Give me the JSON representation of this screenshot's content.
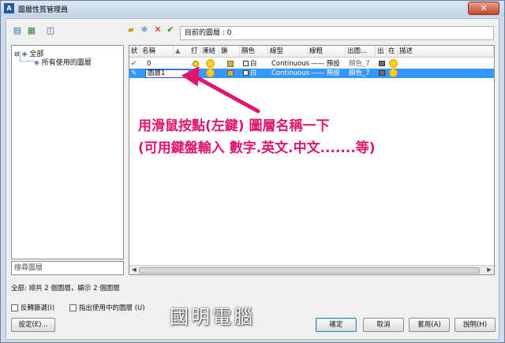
{
  "window": {
    "title": "圖層性質管理員",
    "close_glyph": "✕"
  },
  "toolbar": {
    "left_icons": [
      "new-property-filter-icon",
      "new-group-filter-icon",
      "layer-states-icon"
    ],
    "right_icons": [
      "new-layer-icon",
      "new-layer-vp-frozen-icon",
      "delete-layer-icon",
      "set-current-icon"
    ],
    "current_layer_label": "目前的圖層 : 0"
  },
  "filter_tree": {
    "items": [
      "全部",
      "所有使用的圖層"
    ]
  },
  "search": {
    "placeholder": "搜尋圖層"
  },
  "grid": {
    "headers": [
      "狀",
      "名稱",
      "▲",
      "打",
      "凍結",
      "鎖",
      "顏色",
      "線型",
      "線粗",
      "出圖...",
      "出",
      "在",
      "描述"
    ],
    "rows": [
      {
        "status": "✔",
        "name": "0",
        "color": "白",
        "linetype": "Continuous",
        "lineweight": "—— 預設",
        "plotstyle": "顏色_7",
        "selected": false
      },
      {
        "status": "✎",
        "name": "圖層1",
        "color": "白",
        "linetype": "Continuous",
        "lineweight": "—— 預設",
        "plotstyle": "顏色_7",
        "selected": true
      }
    ]
  },
  "callout": {
    "line1": "用滑鼠按點(左鍵) 圖層名稱一下",
    "line2": "(可用鍵盤輸入 數字.英文.中文.......等)",
    "color": "#e0156e"
  },
  "status_text": "全部: 總共 2 個圖層，顯示 2 個圖層",
  "checkboxes": {
    "invert": "反轉篩選(I)",
    "indicate": "指出使用中的圖層 (U)"
  },
  "buttons": {
    "settings": "設定(E)...",
    "ok": "確定",
    "cancel": "取消",
    "apply": "套用(A)",
    "help": "說明(H)"
  },
  "watermark": "國明電腦"
}
